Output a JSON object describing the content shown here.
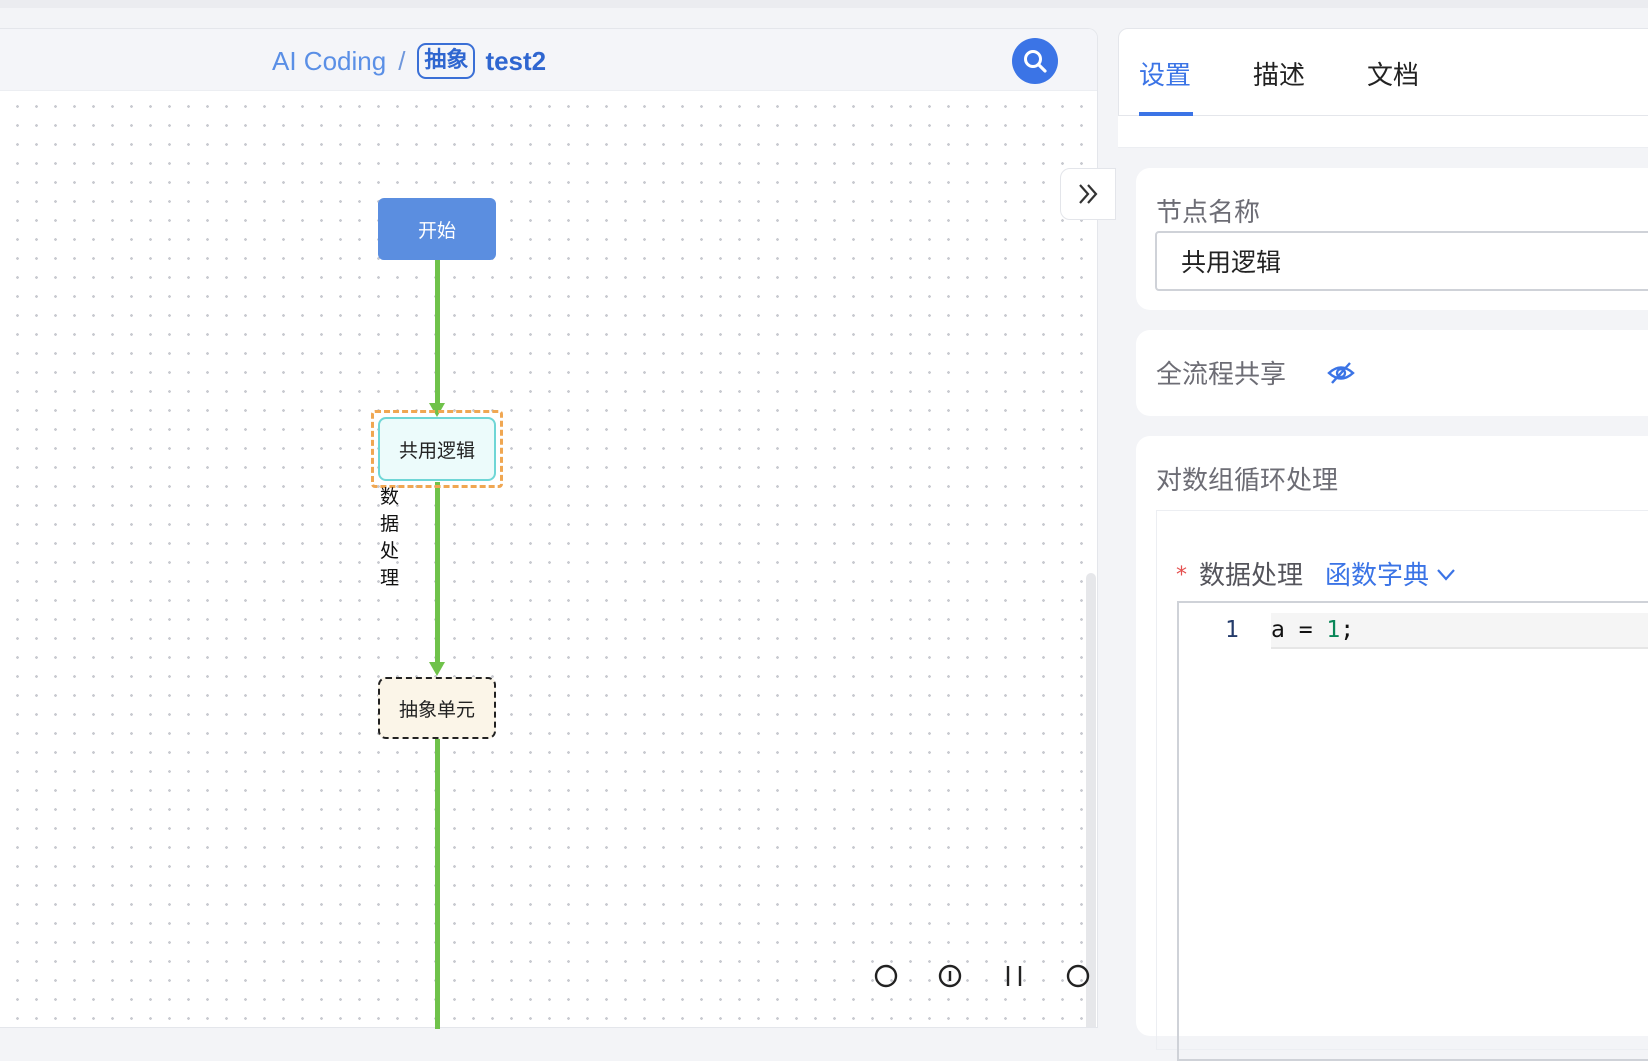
{
  "breadcrumb": {
    "root": "AI Coding",
    "separator": "/",
    "tag": "抽象",
    "name": "test2"
  },
  "flow": {
    "start": "开始",
    "shared": "共用逻辑",
    "shared_sub": "数据处理",
    "abstract": "抽象单元"
  },
  "tabs": [
    {
      "label": "设置",
      "active": true
    },
    {
      "label": "描述",
      "active": false
    },
    {
      "label": "文档",
      "active": false
    }
  ],
  "settings": {
    "node_name_label": "节点名称",
    "node_name_value": "共用逻辑",
    "share_label": "全流程共享",
    "loop_label": "对数组循环处理",
    "required_mark": "*",
    "data_label": "数据处理",
    "dict_link": "函数字典"
  },
  "editor": {
    "line_number": "1",
    "code_prefix": "a = ",
    "code_number": "1",
    "code_suffix": ";"
  },
  "colors": {
    "accent": "#3b74e6",
    "edge": "#6fc24a",
    "selection": "#f0a752"
  }
}
